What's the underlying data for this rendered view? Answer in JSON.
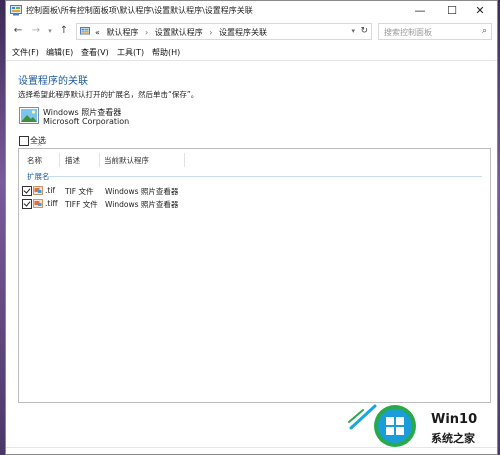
{
  "window": {
    "title": "控制面板\\所有控制面板项\\默认程序\\设置默认程序\\设置程序关联",
    "minimize": "—",
    "maximize": "☐",
    "close": "✕"
  },
  "nav": {
    "back": "←",
    "forward": "→",
    "dropdown": "▾",
    "up": "↑",
    "address_prefix": "«",
    "crumbs": [
      "默认程序",
      "设置默认程序",
      "设置程序关联"
    ],
    "crumb_sep": "›",
    "refresh": "↻",
    "search_placeholder": "搜索控制面板",
    "search_icon": "⌕"
  },
  "menu": [
    "文件(F)",
    "编辑(E)",
    "查看(V)",
    "工具(T)",
    "帮助(H)"
  ],
  "content": {
    "heading": "设置程序的关联",
    "instruction": "选择希望此程序默认打开的扩展名，然后单击“保存”。",
    "app_name": "Windows 照片查看器",
    "app_publisher": "Microsoft Corporation",
    "select_all": "全选"
  },
  "list": {
    "sort_indicator": "^",
    "columns": [
      "名称",
      "描述",
      "当前默认程序"
    ],
    "group": "扩展名",
    "rows": [
      {
        "name": ".tif",
        "desc": "TIF 文件",
        "default": "Windows 照片查看器",
        "checked": true
      },
      {
        "name": ".tiff",
        "desc": "TIFF 文件",
        "default": "Windows 照片查看器",
        "checked": true
      }
    ]
  },
  "watermark": {
    "title": "Win10",
    "subtitle": "系统之家"
  },
  "colors": {
    "accent": "#1e5aa0",
    "logo_blue": "#1aa5e5",
    "logo_green": "#2aa94a"
  }
}
